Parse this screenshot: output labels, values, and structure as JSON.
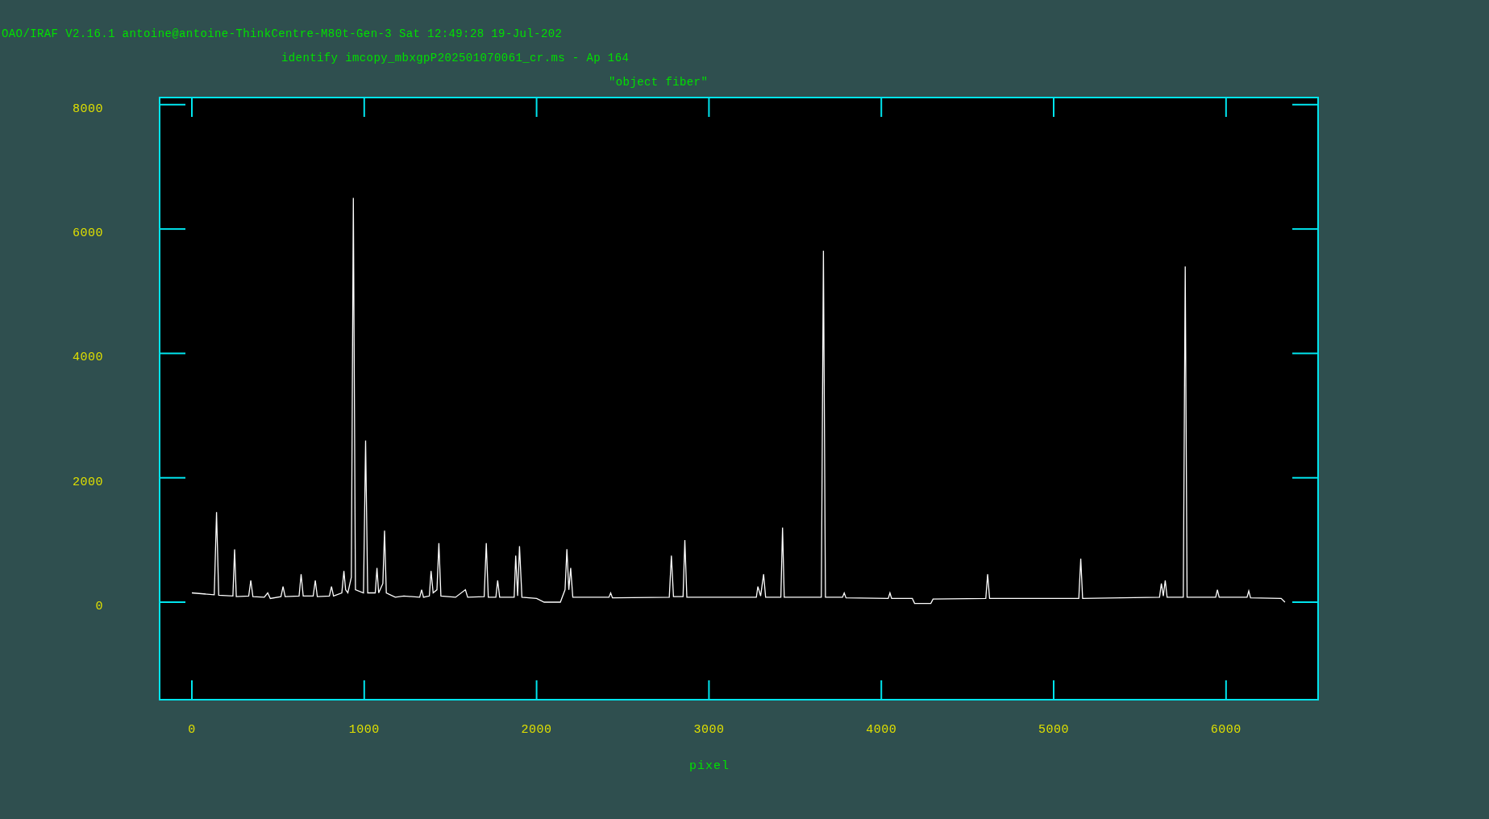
{
  "header": {
    "banner": "OAO/IRAF V2.16.1 antoine@antoine-ThinkCentre-M80t-Gen-3 Sat 12:49:28 19-Jul-202",
    "title": "identify imcopy_mbxgpP202501070061_cr.ms - Ap 164",
    "subtitle": "\"object fiber\""
  },
  "plot": {
    "chart_data": {
      "type": "line",
      "xlabel": "pixel",
      "xlim": [
        -187,
        6534
      ],
      "ylim": [
        -1568,
        8114
      ],
      "xticks": [
        0,
        1000,
        2000,
        3000,
        4000,
        5000,
        6000
      ],
      "yticks": [
        0,
        2000,
        4000,
        6000,
        8000
      ],
      "x": [
        0,
        130,
        143,
        156,
        238,
        248,
        258,
        330,
        342,
        354,
        420,
        440,
        455,
        517,
        529,
        541,
        622,
        634,
        646,
        704,
        716,
        728,
        798,
        810,
        822,
        870,
        882,
        892,
        905,
        925,
        937,
        949,
        996,
        1008,
        1020,
        1064,
        1074,
        1084,
        1108,
        1118,
        1128,
        1180,
        1230,
        1322,
        1333,
        1344,
        1378,
        1388,
        1400,
        1422,
        1433,
        1445,
        1530,
        1587,
        1600,
        1696,
        1708,
        1720,
        1764,
        1774,
        1786,
        1870,
        1879,
        1890,
        1901,
        1915,
        2000,
        2044,
        2138,
        2165,
        2176,
        2187,
        2198,
        2210,
        2420,
        2430,
        2440,
        2770,
        2782,
        2794,
        2850,
        2860,
        2872,
        3275,
        3284,
        3300,
        3317,
        3329,
        3417,
        3427,
        3437,
        3652,
        3664,
        3676,
        3775,
        3785,
        3795,
        4040,
        4050,
        4060,
        4180,
        4193,
        4287,
        4300,
        4606,
        4617,
        4628,
        5146,
        5157,
        5168,
        5614,
        5625,
        5636,
        5647,
        5658,
        5752,
        5763,
        5774,
        5940,
        5950,
        5960,
        6122,
        6132,
        6142,
        6320,
        6342
      ],
      "series": [
        {
          "color": "#ffffff",
          "values": [
            150,
            120,
            1450,
            110,
            100,
            850,
            90,
            100,
            350,
            90,
            80,
            150,
            60,
            90,
            250,
            90,
            100,
            450,
            100,
            100,
            350,
            90,
            100,
            250,
            100,
            150,
            500,
            200,
            150,
            400,
            6500,
            200,
            150,
            2600,
            150,
            150,
            550,
            150,
            300,
            1150,
            150,
            80,
            100,
            80,
            200,
            80,
            100,
            500,
            150,
            200,
            950,
            100,
            80,
            200,
            80,
            90,
            950,
            80,
            80,
            350,
            80,
            80,
            750,
            100,
            900,
            80,
            60,
            0,
            0,
            200,
            850,
            200,
            550,
            80,
            80,
            150,
            70,
            80,
            750,
            90,
            90,
            1000,
            80,
            80,
            250,
            100,
            450,
            80,
            80,
            1200,
            80,
            80,
            5650,
            80,
            80,
            150,
            70,
            60,
            150,
            60,
            60,
            -20,
            -20,
            50,
            60,
            450,
            60,
            60,
            700,
            60,
            80,
            300,
            100,
            350,
            80,
            80,
            5400,
            80,
            80,
            200,
            80,
            80,
            180,
            70,
            60,
            0
          ]
        }
      ]
    }
  }
}
